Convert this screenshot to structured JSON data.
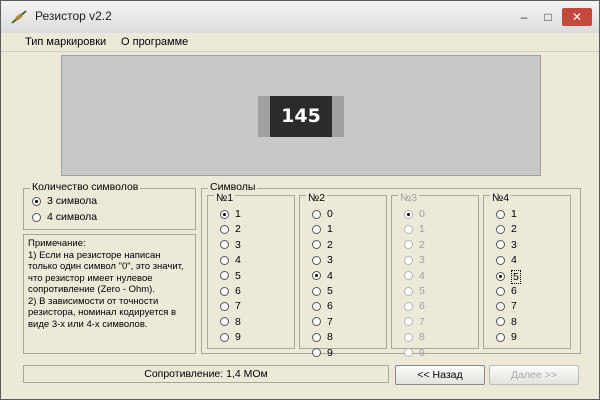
{
  "window": {
    "title": "Резистор v2.2",
    "min": "–",
    "max": "□",
    "close": "✕"
  },
  "menu": [
    "Тип маркировки",
    "О программе"
  ],
  "preview": {
    "code": "145"
  },
  "count_group": {
    "label": "Количество символов",
    "options": [
      "3 символа",
      "4 символа"
    ],
    "selected": "3 символа"
  },
  "notes": {
    "p1": "Примечание:",
    "p2": "1) Если на резисторе написан только один символ \"0\", это значит, что резистор имеет нулевое сопротивление (Zero - Ohm).",
    "p3": "2) В зависимости от точности резистора, номинал кодируется в виде 3-х или 4-х символов."
  },
  "symbols": {
    "label": "Символы",
    "columns": [
      {
        "header": "№1",
        "options": [
          "1",
          "2",
          "3",
          "4",
          "5",
          "6",
          "7",
          "8",
          "9"
        ],
        "selected": "1",
        "enabled": true
      },
      {
        "header": "№2",
        "options": [
          "0",
          "1",
          "2",
          "3",
          "4",
          "5",
          "6",
          "7",
          "8",
          "9"
        ],
        "selected": "4",
        "enabled": true
      },
      {
        "header": "№3",
        "options": [
          "0",
          "1",
          "2",
          "3",
          "4",
          "5",
          "6",
          "7",
          "8",
          "9"
        ],
        "selected": "0",
        "enabled": false
      },
      {
        "header": "№4",
        "options": [
          "1",
          "2",
          "3",
          "4",
          "5",
          "6",
          "7",
          "8",
          "9"
        ],
        "selected": "5",
        "enabled": true
      }
    ]
  },
  "status": {
    "text": "Сопротивление: 1,4 МОм"
  },
  "buttons": {
    "back": "<< Назад",
    "next": "Далее >>"
  }
}
